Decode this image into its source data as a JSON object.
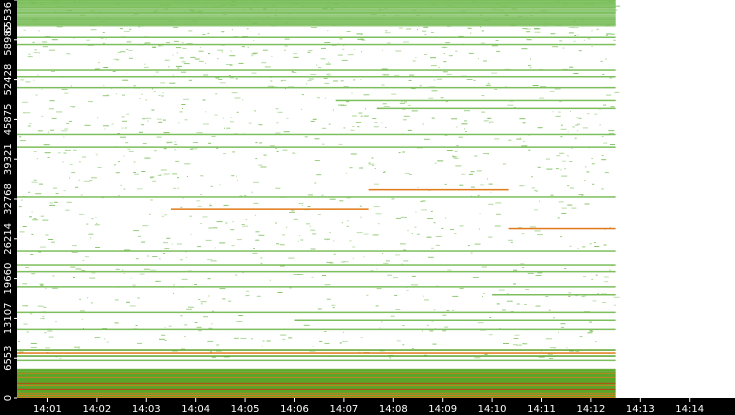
{
  "chart_data": {
    "type": "heatmap",
    "title": "",
    "xlabel": "",
    "ylabel": "",
    "x_ticks": [
      "14:01",
      "14:02",
      "14:03",
      "14:04",
      "14:05",
      "14:06",
      "14:07",
      "14:08",
      "14:09",
      "14:10",
      "14:11",
      "14:12",
      "14:13",
      "14:14"
    ],
    "y_ticks": [
      0,
      6553,
      13107,
      19660,
      26214,
      32768,
      39321,
      45875,
      52428,
      58982,
      65536
    ],
    "x_range": [
      "14:00:23",
      "14:14:55"
    ],
    "data_end": "14:12:30",
    "y_range": [
      0,
      65536
    ],
    "grid": false,
    "legend": "none",
    "colors": {
      "background": "#ffffff",
      "frame": "#000000",
      "low": "#7cbf5c",
      "mid": "#5aa52a",
      "high": "#e07a1a",
      "peak": "#c83a10",
      "text": "#ffffff"
    },
    "sustained_streams": [
      {
        "port": 65536,
        "start": "14:00:23",
        "end": "14:12:30",
        "level": "low"
      },
      {
        "port": 65100,
        "start": "14:00:23",
        "end": "14:12:30",
        "level": "low"
      },
      {
        "port": 64300,
        "start": "14:00:23",
        "end": "14:12:30",
        "level": "low"
      },
      {
        "port": 63400,
        "start": "14:00:23",
        "end": "14:12:30",
        "level": "low"
      },
      {
        "port": 59400,
        "start": "14:00:23",
        "end": "14:12:30",
        "level": "low"
      },
      {
        "port": 58200,
        "start": "14:00:23",
        "end": "14:12:30",
        "level": "low"
      },
      {
        "port": 54000,
        "start": "14:00:23",
        "end": "14:12:30",
        "level": "low"
      },
      {
        "port": 52900,
        "start": "14:00:23",
        "end": "14:12:30",
        "level": "low"
      },
      {
        "port": 51100,
        "start": "14:00:23",
        "end": "14:12:30",
        "level": "low"
      },
      {
        "port": 49000,
        "start": "14:06:50",
        "end": "14:12:30",
        "level": "low"
      },
      {
        "port": 47700,
        "start": "14:07:40",
        "end": "14:12:30",
        "level": "low"
      },
      {
        "port": 43400,
        "start": "14:00:23",
        "end": "14:12:30",
        "level": "low"
      },
      {
        "port": 41300,
        "start": "14:00:23",
        "end": "14:12:30",
        "level": "low"
      },
      {
        "port": 34300,
        "start": "14:07:30",
        "end": "14:10:20",
        "level": "high"
      },
      {
        "port": 33100,
        "start": "14:00:23",
        "end": "14:12:30",
        "level": "low"
      },
      {
        "port": 31100,
        "start": "14:03:30",
        "end": "14:07:30",
        "level": "high"
      },
      {
        "port": 27900,
        "start": "14:10:20",
        "end": "14:12:30",
        "level": "high"
      },
      {
        "port": 24200,
        "start": "14:00:23",
        "end": "14:12:30",
        "level": "low"
      },
      {
        "port": 21900,
        "start": "14:00:23",
        "end": "14:12:30",
        "level": "low"
      },
      {
        "port": 20800,
        "start": "14:00:23",
        "end": "14:12:30",
        "level": "low"
      },
      {
        "port": 18300,
        "start": "14:00:23",
        "end": "14:12:30",
        "level": "low"
      },
      {
        "port": 17000,
        "start": "14:10:00",
        "end": "14:12:30",
        "level": "low"
      },
      {
        "port": 14100,
        "start": "14:00:23",
        "end": "14:12:30",
        "level": "low"
      },
      {
        "port": 12800,
        "start": "14:06:00",
        "end": "14:12:30",
        "level": "low"
      },
      {
        "port": 11300,
        "start": "14:00:23",
        "end": "14:12:30",
        "level": "low"
      },
      {
        "port": 7900,
        "start": "14:00:23",
        "end": "14:12:30",
        "level": "mid"
      },
      {
        "port": 7400,
        "start": "14:00:23",
        "end": "14:12:30",
        "level": "high"
      },
      {
        "port": 6900,
        "start": "14:00:23",
        "end": "14:12:30",
        "level": "mid"
      },
      {
        "port": 6200,
        "start": "14:00:23",
        "end": "14:12:30",
        "level": "low"
      }
    ],
    "dense_band": {
      "port_min": 0,
      "port_max": 4800,
      "start": "14:00:23",
      "end": "14:12:30"
    }
  }
}
